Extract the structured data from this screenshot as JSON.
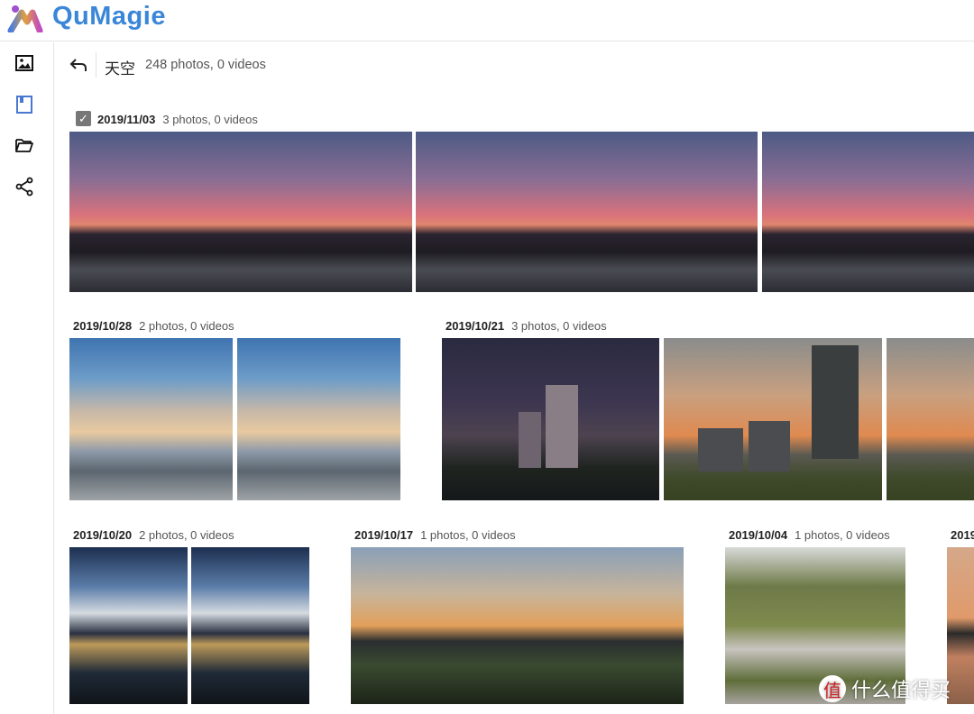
{
  "app": {
    "name": "QuMagie"
  },
  "sidebar": {
    "items": [
      {
        "name": "photos",
        "icon": "image-icon"
      },
      {
        "name": "albums",
        "icon": "album-icon"
      },
      {
        "name": "folders",
        "icon": "folder-icon"
      },
      {
        "name": "shared",
        "icon": "share-icon"
      }
    ]
  },
  "header": {
    "title": "天空",
    "count": "248 photos, 0 videos"
  },
  "groups": [
    {
      "date": "2019/11/03",
      "count": "3 photos, 0 videos",
      "selected": true
    },
    {
      "date": "2019/10/28",
      "count": "2 photos, 0 videos"
    },
    {
      "date": "2019/10/21",
      "count": "3 photos, 0 videos"
    },
    {
      "date": "2019/10/20",
      "count": "2 photos, 0 videos"
    },
    {
      "date": "2019/10/17",
      "count": "1 photos, 0 videos"
    },
    {
      "date": "2019/10/04",
      "count": "1 photos, 0 videos"
    },
    {
      "date": "2019"
    }
  ],
  "watermark": {
    "badge": "值",
    "text": "什么值得买"
  },
  "colors": {
    "brand": "#3a86d8",
    "active_icon": "#4a78d0"
  }
}
